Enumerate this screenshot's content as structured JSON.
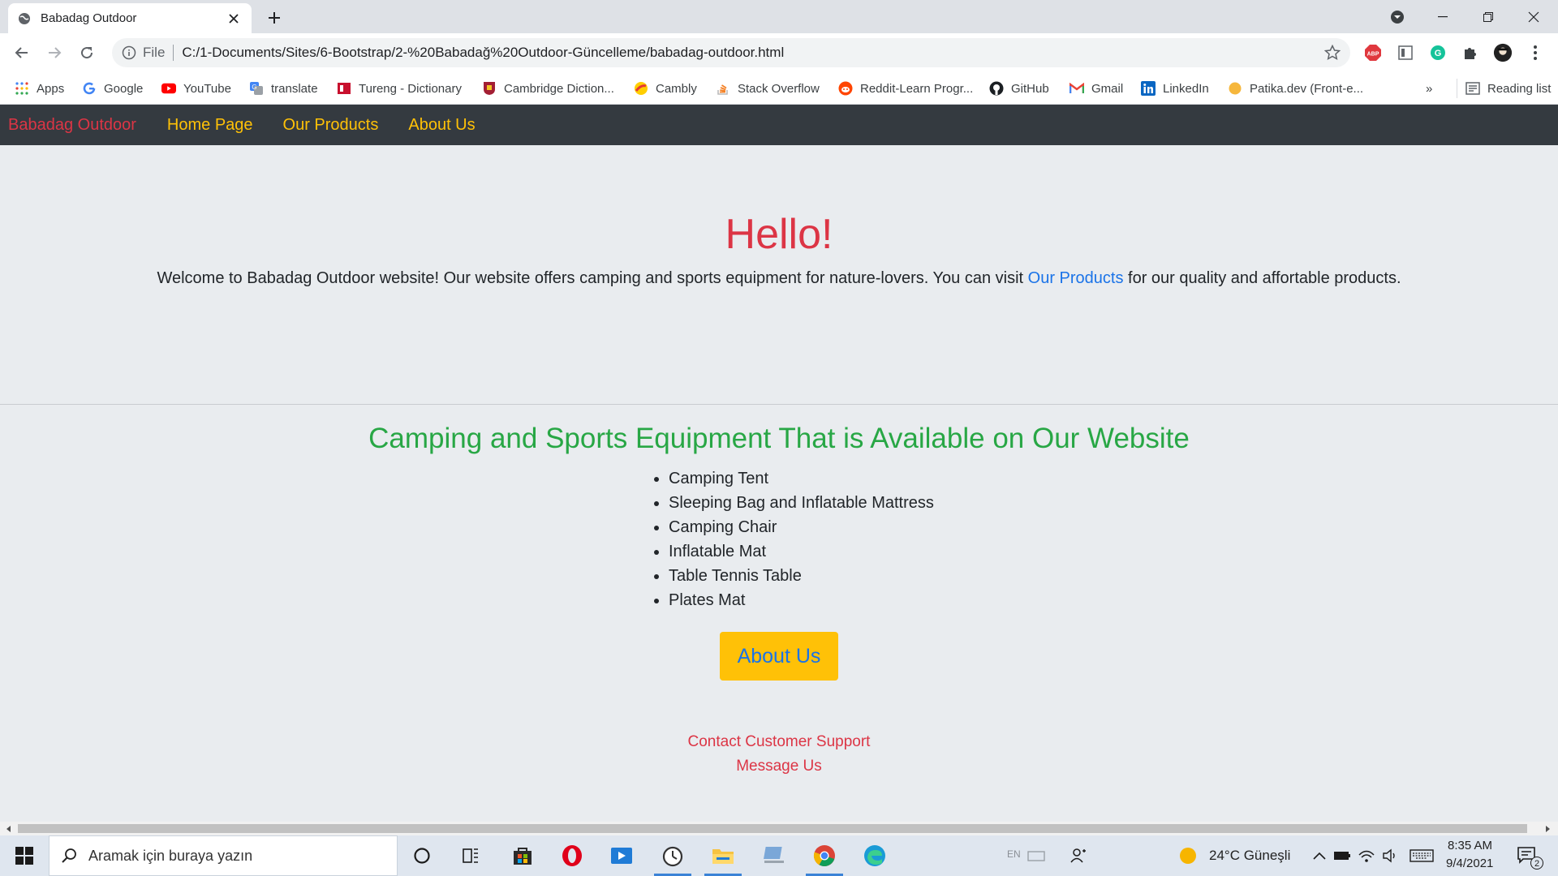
{
  "browser": {
    "tab_title": "Babadag Outdoor",
    "scheme_label": "File",
    "url": "C:/1-Documents/Sites/6-Bootstrap/2-%20Babadağ%20Outdoor-Güncelleme/babadag-outdoor.html"
  },
  "bookmarks": {
    "items": [
      {
        "label": "Apps",
        "icon": "apps-grid-icon"
      },
      {
        "label": "Google",
        "icon": "google-icon"
      },
      {
        "label": "YouTube",
        "icon": "youtube-icon"
      },
      {
        "label": "translate",
        "icon": "translate-icon"
      },
      {
        "label": "Tureng - Dictionary",
        "icon": "tureng-icon"
      },
      {
        "label": "Cambridge Diction...",
        "icon": "cambridge-icon"
      },
      {
        "label": "Cambly",
        "icon": "cambly-icon"
      },
      {
        "label": "Stack Overflow",
        "icon": "stackoverflow-icon"
      },
      {
        "label": "Reddit-Learn Progr...",
        "icon": "reddit-icon"
      },
      {
        "label": "GitHub",
        "icon": "github-icon"
      },
      {
        "label": "Gmail",
        "icon": "gmail-icon"
      },
      {
        "label": "LinkedIn",
        "icon": "linkedin-icon"
      },
      {
        "label": "Patika.dev (Front-e...",
        "icon": "patika-icon"
      }
    ],
    "overflow": "»",
    "reading_list": "Reading list"
  },
  "site": {
    "brand": "Babadag Outdoor",
    "nav": [
      "Home Page",
      "Our Products",
      "About Us"
    ],
    "hero_title": "Hello!",
    "hero_text_before": "Welcome to Babadag Outdoor website! Our website offers camping and sports equipment for nature-lovers. You can visit ",
    "hero_link": "Our Products",
    "hero_text_after": " for our quality and affortable products.",
    "equipment_title": "Camping and Sports Equipment That is Available on Our Website",
    "equipment": [
      "Camping Tent",
      "Sleeping Bag and Inflatable Mattress",
      "Camping Chair",
      "Inflatable Mat",
      "Table Tennis Table",
      "Plates Mat"
    ],
    "about_button": "About Us",
    "footer_links": [
      "Contact Customer Support",
      "Message Us"
    ]
  },
  "taskbar": {
    "search_placeholder": "Aramak için buraya yazın",
    "weather": "24°C  Güneşli",
    "lang": "EN",
    "time": "8:35 AM",
    "date": "9/4/2021",
    "notification_count": "2"
  },
  "colors": {
    "navbar": "#343a40",
    "brand": "#dc3545",
    "nav_link": "#ffc107",
    "heading_green": "#28a745",
    "link_blue": "#1a73e8"
  }
}
